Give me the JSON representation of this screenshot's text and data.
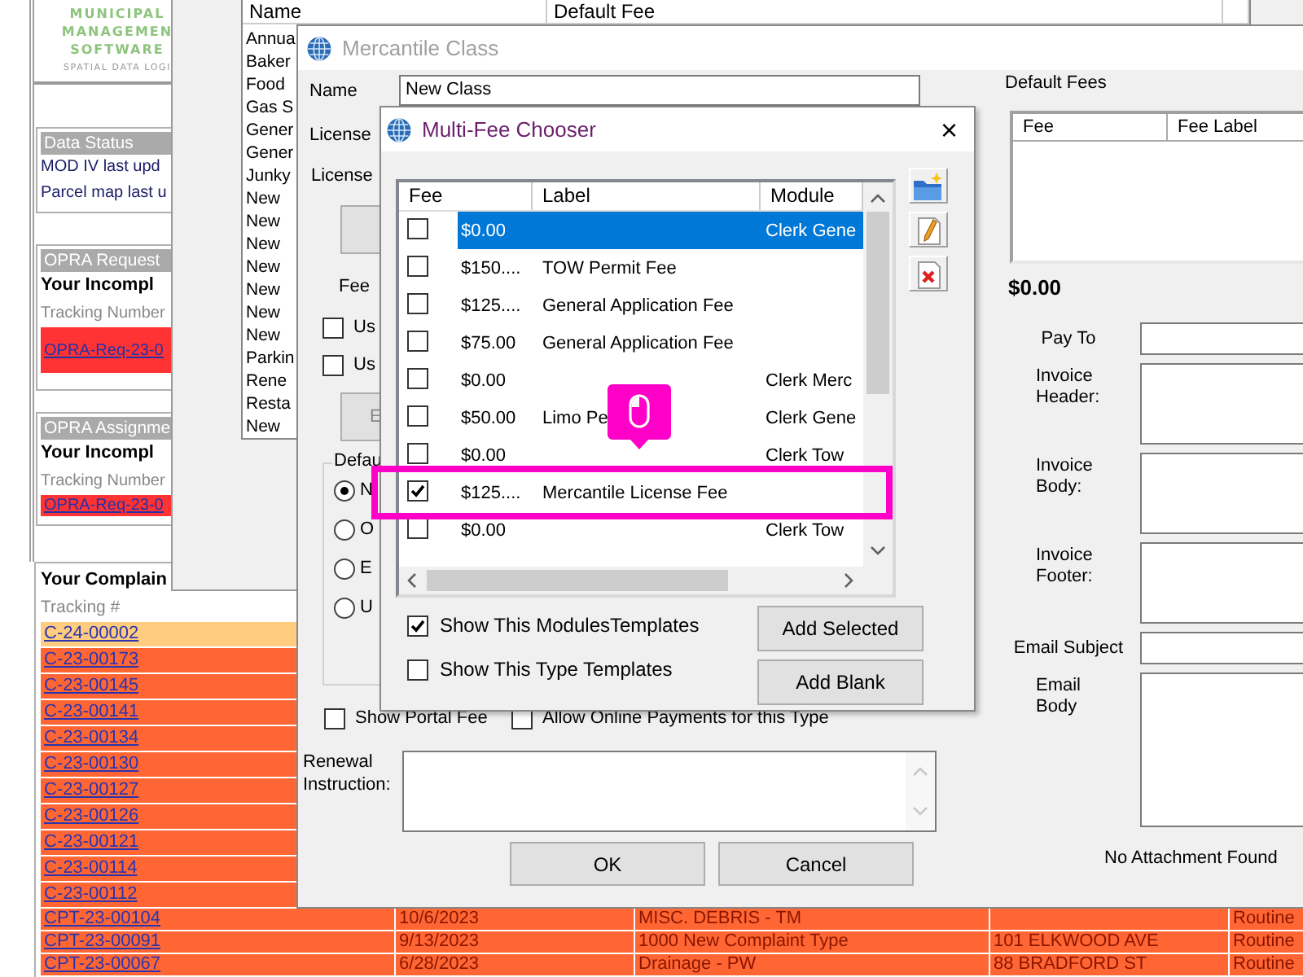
{
  "left_panel": {
    "logo": {
      "lines": [
        "MUNICIPAL",
        "MANAGEMEN",
        "SOFTWARE"
      ],
      "tagline": "SPATIAL DATA LOGI"
    },
    "data_status": {
      "title": "Data Status",
      "lines": [
        "MOD IV last upd",
        "Parcel map last u"
      ]
    },
    "opra_requests": {
      "title": "OPRA Request",
      "heading": "Your Incompl",
      "column": "Tracking Number",
      "rows": [
        "OPRA-Req-23-0"
      ]
    },
    "opra_assignments": {
      "title": "OPRA Assignme",
      "heading": "Your Incompl",
      "column": "Tracking Number",
      "rows": [
        "OPRA-Req-23-0"
      ]
    }
  },
  "complaints": {
    "title": "Your Complain",
    "column": "Tracking #",
    "rows": [
      {
        "tracking": "C-24-00002",
        "color": "#ffcc80"
      },
      {
        "tracking": "C-23-00173",
        "color": "#ff6633"
      },
      {
        "tracking": "C-23-00145",
        "color": "#ff6633"
      },
      {
        "tracking": "C-23-00141",
        "color": "#ff6633"
      },
      {
        "tracking": "C-23-00134",
        "color": "#ff6633"
      },
      {
        "tracking": "C-23-00130",
        "color": "#ff6633"
      },
      {
        "tracking": "C-23-00127",
        "color": "#ff6633"
      },
      {
        "tracking": "C-23-00126",
        "color": "#ff6633"
      },
      {
        "tracking": "C-23-00121",
        "color": "#ff6633"
      },
      {
        "tracking": "C-23-00114",
        "color": "#ff6633"
      },
      {
        "tracking": "C-23-00112",
        "color": "#ff6633"
      },
      {
        "tracking": "CPT-23-00104",
        "date": "10/6/2023",
        "type": "MISC. DEBRIS - TM",
        "priority": "Routine",
        "color": "#ff6633"
      },
      {
        "tracking": "CPT-23-00091",
        "date": "9/13/2023",
        "type": "1000 New Complaint Type",
        "address": "101 ELKWOOD AVE",
        "priority": "Routine",
        "color": "#ff6633"
      },
      {
        "tracking": "CPT-23-00067",
        "date": "6/28/2023",
        "type": "Drainage - PW",
        "address": "88 BRADFORD ST",
        "priority": "Routine",
        "color": "#ff6633"
      }
    ]
  },
  "list_window": {
    "columns": [
      "Name",
      "Default Fee"
    ],
    "items": [
      "Annua",
      "Baker",
      "Food",
      "Gas S",
      "Gener",
      "Gener",
      "Junky",
      "New",
      "New",
      "New",
      "New",
      "New",
      "New",
      "New",
      "Parkin",
      "Rene",
      "Resta",
      "New"
    ]
  },
  "class_dialog": {
    "title": "Mercantile Class",
    "name_label": "Name",
    "name_value": "New Class",
    "labels": [
      "License",
      "License"
    ],
    "fee_label": "Fee",
    "options": [
      {
        "label": "Us",
        "checked": false
      },
      {
        "label": "Us",
        "checked": false
      }
    ],
    "button": "E",
    "default_group": {
      "title": "Defau",
      "radios": [
        {
          "label": "N",
          "selected": true
        },
        {
          "label": "O",
          "selected": false
        },
        {
          "label": "E",
          "selected": false
        },
        {
          "label": "U",
          "selected": false
        }
      ]
    },
    "flags": [
      {
        "label": "Show Portal Fee",
        "checked": false
      },
      {
        "label": "Allow Online Payments for this Type",
        "checked": false
      }
    ],
    "renewal_label": "Renewal Instruction:",
    "buttons": [
      "OK",
      "Cancel"
    ],
    "default_fees": {
      "title": "Default Fees",
      "columns": [
        "Fee",
        "Fee Label"
      ],
      "total": "$0.00"
    },
    "invoice_fields": [
      {
        "label": "Pay To",
        "kind": "line"
      },
      {
        "label": "Invoice Header:",
        "kind": "box"
      },
      {
        "label": "Invoice Body:",
        "kind": "box"
      },
      {
        "label": "Invoice Footer:",
        "kind": "box"
      },
      {
        "label": "Email Subject",
        "kind": "line"
      },
      {
        "label": "Email Body",
        "kind": "box"
      }
    ],
    "attachment_status": "No Attachment Found"
  },
  "fee_chooser": {
    "title": "Multi-Fee Chooser",
    "close": "×",
    "columns": [
      "Fee",
      "Label",
      "Module"
    ],
    "rows": [
      {
        "checked": false,
        "selected": true,
        "highlighted": false,
        "fee": "$0.00",
        "module": "Clerk Gene"
      },
      {
        "checked": false,
        "selected": false,
        "highlighted": false,
        "fee": "$150....",
        "label": "TOW Permit Fee"
      },
      {
        "checked": false,
        "selected": false,
        "highlighted": false,
        "fee": "$125....",
        "label": "General Application Fee"
      },
      {
        "checked": false,
        "selected": false,
        "highlighted": false,
        "fee": "$75.00",
        "label": "General Application Fee"
      },
      {
        "checked": false,
        "selected": false,
        "highlighted": false,
        "fee": "$0.00",
        "module": "Clerk Merc"
      },
      {
        "checked": false,
        "selected": false,
        "highlighted": false,
        "fee": "$50.00",
        "label": "Limo Pe",
        "module": "Clerk Gene"
      },
      {
        "checked": false,
        "selected": false,
        "highlighted": false,
        "fee": "$0.00",
        "module": "Clerk Tow"
      },
      {
        "checked": true,
        "selected": false,
        "highlighted": true,
        "fee": "$125....",
        "label": "Mercantile License Fee"
      },
      {
        "checked": false,
        "selected": false,
        "highlighted": false,
        "fee": "$0.00",
        "module": "Clerk Tow"
      }
    ],
    "toggles": [
      {
        "label": "Show This ModulesTemplates",
        "checked": true
      },
      {
        "label": "Show This Type Templates",
        "checked": false
      }
    ],
    "buttons": [
      "Add Selected",
      "Add Blank"
    ]
  }
}
